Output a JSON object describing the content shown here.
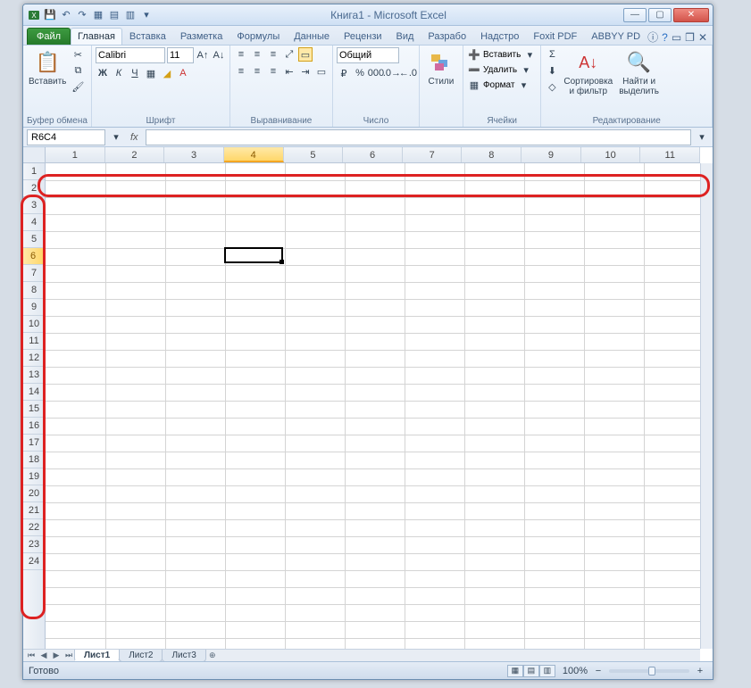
{
  "title": "Книга1  -  Microsoft Excel",
  "tabs": {
    "file": "Файл",
    "list": [
      "Главная",
      "Вставка",
      "Разметка",
      "Формулы",
      "Данные",
      "Рецензи",
      "Вид",
      "Разрабо",
      "Надстро",
      "Foxit PDF",
      "ABBYY PD"
    ],
    "active_index": 0
  },
  "ribbon": {
    "clipboard": {
      "label": "Буфер обмена",
      "paste": "Вставить"
    },
    "font": {
      "label": "Шрифт",
      "name": "Calibri",
      "size": "11"
    },
    "align": {
      "label": "Выравнивание"
    },
    "number": {
      "label": "Число",
      "format": "Общий"
    },
    "styles": {
      "label": "",
      "styles_btn": "Стили"
    },
    "cells": {
      "label": "Ячейки",
      "insert": "Вставить",
      "delete": "Удалить",
      "format": "Формат"
    },
    "editing": {
      "label": "Редактирование",
      "sort": "Сортировка\nи фильтр",
      "find": "Найти и\nвыделить"
    }
  },
  "namebox": "R6C4",
  "columns": [
    "1",
    "2",
    "3",
    "4",
    "5",
    "6",
    "7",
    "8",
    "9",
    "10",
    "11"
  ],
  "rows": [
    "1",
    "2",
    "3",
    "4",
    "5",
    "6",
    "7",
    "8",
    "9",
    "10",
    "11",
    "12",
    "13",
    "14",
    "15",
    "16",
    "17",
    "18",
    "19",
    "20",
    "21",
    "22",
    "23",
    "24"
  ],
  "selected_col_index": 3,
  "selected_row_index": 5,
  "sheets": [
    "Лист1",
    "Лист2",
    "Лист3"
  ],
  "active_sheet": 0,
  "status": "Готово",
  "zoom": "100%"
}
